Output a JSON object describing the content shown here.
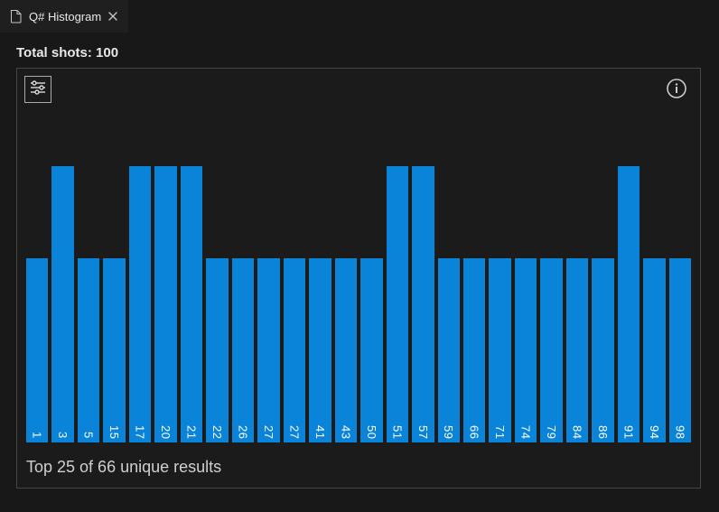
{
  "tab": {
    "title": "Q# Histogram"
  },
  "header": {
    "shots_label": "Total shots: 100"
  },
  "footer": {
    "summary": "Top 25 of 66 unique results"
  },
  "chart_data": {
    "type": "bar",
    "title": "",
    "xlabel": "",
    "ylabel": "",
    "ylim": [
      0,
      3
    ],
    "categories": [
      "1",
      "3",
      "5",
      "15",
      "17",
      "20",
      "21",
      "22",
      "26",
      "27",
      "27",
      "41",
      "43",
      "50",
      "51",
      "57",
      "59",
      "66",
      "71",
      "74",
      "79",
      "84",
      "86",
      "91",
      "94",
      "98"
    ],
    "values": [
      2,
      3,
      2,
      2,
      3,
      3,
      3,
      2,
      2,
      2,
      2,
      2,
      2,
      2,
      3,
      3,
      2,
      2,
      2,
      2,
      2,
      2,
      2,
      3,
      2,
      2
    ]
  },
  "colors": {
    "bar": "#0a84d8",
    "panel_border": "#454545",
    "bg": "#181818"
  }
}
